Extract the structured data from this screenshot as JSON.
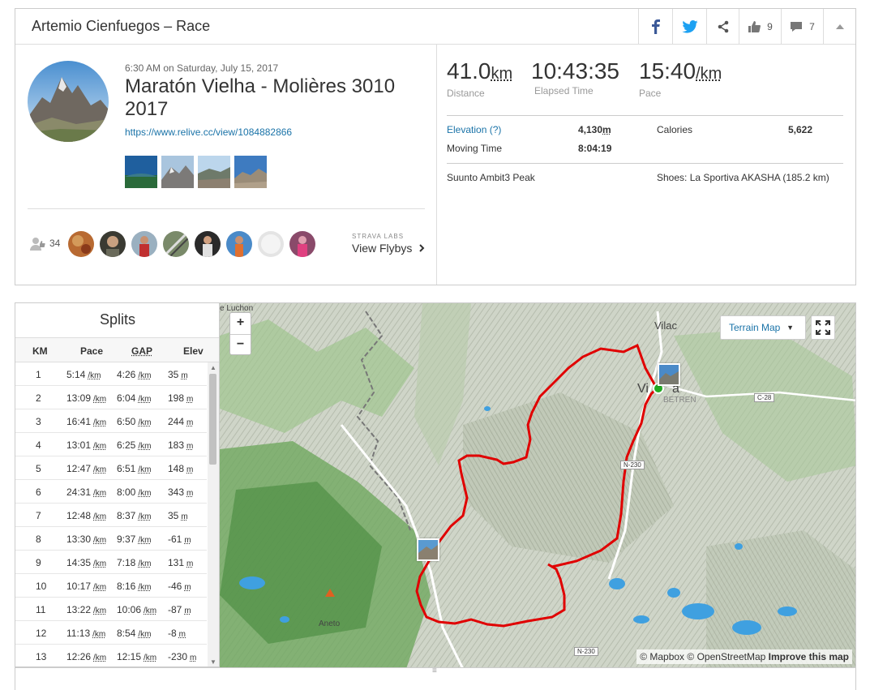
{
  "header": {
    "title": "Artemio Cienfuegos – Race",
    "kudos_count": "9",
    "comments_count": "7"
  },
  "activity": {
    "datetime": "6:30 AM on Saturday, July 15, 2017",
    "name": "Maratón Vielha - Molières 3010 2017",
    "link": "https://www.relive.cc/view/1084882866",
    "kudoers_count": "34",
    "flyby_labs": "STRAVA LABS",
    "flyby_label": "View Flybys"
  },
  "stats": {
    "distance": {
      "value": "41.0",
      "unit": "km",
      "label": "Distance"
    },
    "elapsed": {
      "value": "10:43:35",
      "label": "Elapsed Time"
    },
    "pace": {
      "value": "15:40",
      "unit": "/km",
      "label": "Pace"
    },
    "elevation_label": "Elevation (?)",
    "elevation_value": "4,130",
    "elevation_unit": "m",
    "calories_label": "Calories",
    "calories_value": "5,622",
    "moving_label": "Moving Time",
    "moving_value": "8:04:19",
    "device": "Suunto Ambit3 Peak",
    "shoes": "Shoes: La Sportiva AKASHA (185.2 km)"
  },
  "splits": {
    "title": "Splits",
    "headers": {
      "km": "KM",
      "pace": "Pace",
      "gap": "GAP",
      "elev": "Elev"
    },
    "unit_pace": "/km",
    "unit_elev": "m",
    "rows": [
      {
        "km": "1",
        "pace": "5:14",
        "gap": "4:26",
        "elev": "35"
      },
      {
        "km": "2",
        "pace": "13:09",
        "gap": "6:04",
        "elev": "198"
      },
      {
        "km": "3",
        "pace": "16:41",
        "gap": "6:50",
        "elev": "244"
      },
      {
        "km": "4",
        "pace": "13:01",
        "gap": "6:25",
        "elev": "183"
      },
      {
        "km": "5",
        "pace": "12:47",
        "gap": "6:51",
        "elev": "148"
      },
      {
        "km": "6",
        "pace": "24:31",
        "gap": "8:00",
        "elev": "343"
      },
      {
        "km": "7",
        "pace": "12:48",
        "gap": "8:37",
        "elev": "35"
      },
      {
        "km": "8",
        "pace": "13:30",
        "gap": "9:37",
        "elev": "-61"
      },
      {
        "km": "9",
        "pace": "14:35",
        "gap": "7:18",
        "elev": "131"
      },
      {
        "km": "10",
        "pace": "10:17",
        "gap": "8:16",
        "elev": "-46"
      },
      {
        "km": "11",
        "pace": "13:22",
        "gap": "10:06",
        "elev": "-87"
      },
      {
        "km": "12",
        "pace": "11:13",
        "gap": "8:54",
        "elev": "-8"
      },
      {
        "km": "13",
        "pace": "12:26",
        "gap": "12:15",
        "elev": "-230"
      }
    ]
  },
  "map": {
    "zoom_in": "+",
    "zoom_out": "−",
    "terrain_label": "Terrain Map",
    "attribution_mapbox": "© Mapbox",
    "attribution_osm": "© OpenStreetMap",
    "attribution_improve": "Improve this map",
    "places": {
      "luchon": "e Luchon",
      "vilac": "Vilac",
      "vielha": "Vi",
      "vielha_end": "a",
      "betren": "BETREN",
      "aneto": "Aneto"
    },
    "roads": {
      "c28": "C-28",
      "n230a": "N-230",
      "n230b": "N-230"
    },
    "route_color": "#e00000",
    "start_color": "#22aa22"
  }
}
